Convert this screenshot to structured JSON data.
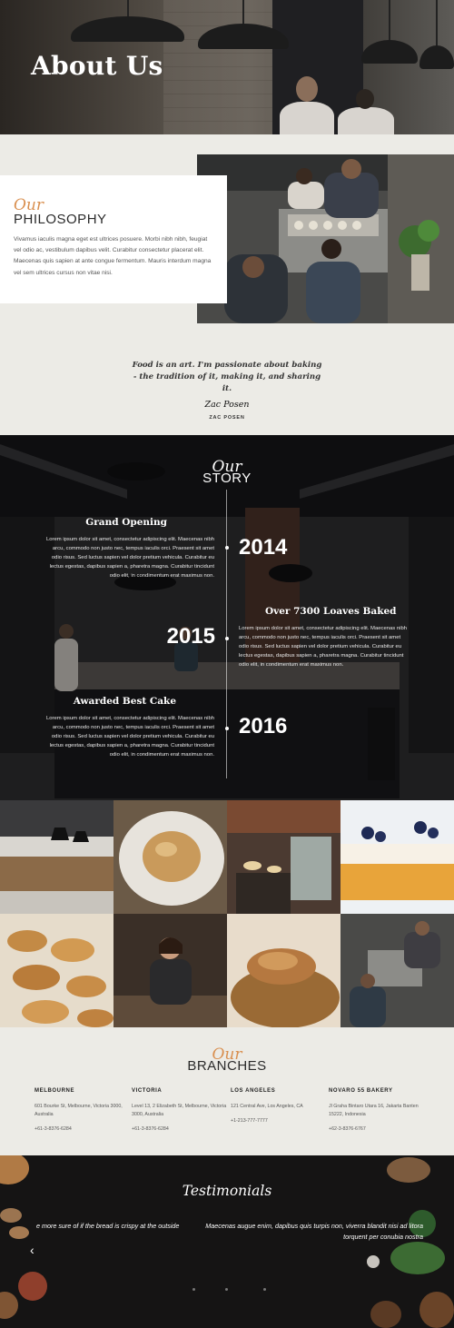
{
  "hero": {
    "title": "About Us"
  },
  "philosophy": {
    "our": "Our",
    "heading": "PHILOSOPHY",
    "text": "Vivamus iaculis magna eget est ultrices posuere. Morbi nibh nibh, feugiat vel odio ac, vestibulum dapibus velit. Curabitur consectetur placerat elit. Maecenas quis sapien at ante congue fermentum. Mauris interdum magna vel sem ultrices cursus non vitae nisi."
  },
  "quote": {
    "text": "Food is an art. I'm passionate about baking - the tradition of it, making it, and sharing it.",
    "signature": "Zac Posen",
    "author": "ZAC POSEN"
  },
  "story": {
    "our": "Our",
    "heading": "STORY",
    "events": [
      {
        "year": "2014",
        "title": "Grand Opening",
        "text": "Lorem ipsum dolor sit amet, consectetur adipiscing elit. Maecenas nibh arcu, commodo non justo nec, tempus iaculis orci. Praesent sit amet odio risus. Sed luctus sapien vel dolor pretium vehicula. Curabitur eu lectus egestas, dapibus sapien a, pharetra magna. Curabitur tincidunt odio elit, in condimentum erat maximus non."
      },
      {
        "year": "2015",
        "title": "Over 7300 Loaves Baked",
        "text": "Lorem ipsum dolor sit amet, consectetur adipiscing elit. Maecenas nibh arcu, commodo non justo nec, tempus iaculis orci. Praesent sit amet odio risus. Sed luctus sapien vel dolor pretium vehicula. Curabitur eu lectus egestas, dapibus sapien a, pharetra magna. Curabitur tincidunt odio elit, in condimentum erat maximus non."
      },
      {
        "year": "2016",
        "title": "Awarded Best Cake",
        "text": "Lorem ipsum dolor sit amet, consectetur adipiscing elit. Maecenas nibh arcu, commodo non justo nec, tempus iaculis orci. Praesent sit amet odio risus. Sed luctus sapien vel dolor pretium vehicula. Curabitur eu lectus egestas, dapibus sapien a, pharetra magna. Curabitur tincidunt odio elit, in condimentum erat maximus non."
      }
    ]
  },
  "branches": {
    "our": "Our",
    "heading": "BRANCHES",
    "items": [
      {
        "name": "MELBOURNE",
        "address": "601 Bourke St, Melbourne, Victoria 3000, Australia",
        "phone": "+61-3-8376-6284"
      },
      {
        "name": "VICTORIA",
        "address": "Level 13, 2 Elizabeth St, Melbourne, Victoria 3000, Australia",
        "phone": "+61-3-8376-6284"
      },
      {
        "name": "LOS ANGELES",
        "address": "121 Central Ave, Los Angeles, CA",
        "phone": "+1-213-777-7777"
      },
      {
        "name": "NOVARO 55 BAKERY",
        "address": "Jl Graha Bintaro Utara 16, Jakarta Banten 15222, Indonesia",
        "phone": "+62-3-8376-6767"
      }
    ]
  },
  "testimonials": {
    "title": "Testimonials",
    "quote_left": "e more sure of if the bread is crispy at the outside",
    "quote_right": "Maecenas augue enim, dapibus quis turpis non, viverra blandit nisi ad litora torquent per conubia nostra",
    "prev": "‹"
  },
  "colors": {
    "accent": "#d98f4f",
    "background": "#ecebe6",
    "dark": "#151414"
  }
}
